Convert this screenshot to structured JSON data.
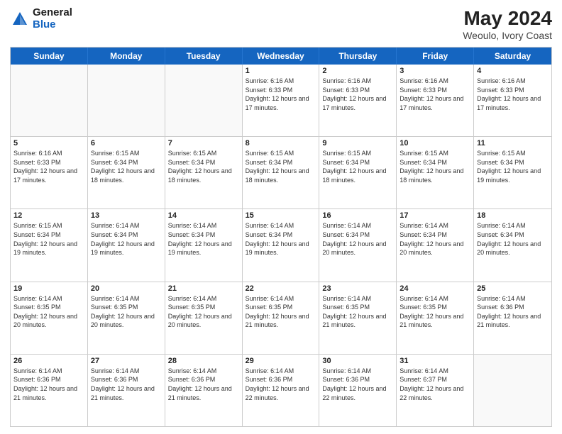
{
  "header": {
    "logo_general": "General",
    "logo_blue": "Blue",
    "month_title": "May 2024",
    "location": "Weoulo, Ivory Coast"
  },
  "days_of_week": [
    "Sunday",
    "Monday",
    "Tuesday",
    "Wednesday",
    "Thursday",
    "Friday",
    "Saturday"
  ],
  "weeks": [
    [
      {
        "day": "",
        "info": ""
      },
      {
        "day": "",
        "info": ""
      },
      {
        "day": "",
        "info": ""
      },
      {
        "day": "1",
        "info": "Sunrise: 6:16 AM\nSunset: 6:33 PM\nDaylight: 12 hours and 17 minutes."
      },
      {
        "day": "2",
        "info": "Sunrise: 6:16 AM\nSunset: 6:33 PM\nDaylight: 12 hours and 17 minutes."
      },
      {
        "day": "3",
        "info": "Sunrise: 6:16 AM\nSunset: 6:33 PM\nDaylight: 12 hours and 17 minutes."
      },
      {
        "day": "4",
        "info": "Sunrise: 6:16 AM\nSunset: 6:33 PM\nDaylight: 12 hours and 17 minutes."
      }
    ],
    [
      {
        "day": "5",
        "info": "Sunrise: 6:16 AM\nSunset: 6:33 PM\nDaylight: 12 hours and 17 minutes."
      },
      {
        "day": "6",
        "info": "Sunrise: 6:15 AM\nSunset: 6:34 PM\nDaylight: 12 hours and 18 minutes."
      },
      {
        "day": "7",
        "info": "Sunrise: 6:15 AM\nSunset: 6:34 PM\nDaylight: 12 hours and 18 minutes."
      },
      {
        "day": "8",
        "info": "Sunrise: 6:15 AM\nSunset: 6:34 PM\nDaylight: 12 hours and 18 minutes."
      },
      {
        "day": "9",
        "info": "Sunrise: 6:15 AM\nSunset: 6:34 PM\nDaylight: 12 hours and 18 minutes."
      },
      {
        "day": "10",
        "info": "Sunrise: 6:15 AM\nSunset: 6:34 PM\nDaylight: 12 hours and 18 minutes."
      },
      {
        "day": "11",
        "info": "Sunrise: 6:15 AM\nSunset: 6:34 PM\nDaylight: 12 hours and 19 minutes."
      }
    ],
    [
      {
        "day": "12",
        "info": "Sunrise: 6:15 AM\nSunset: 6:34 PM\nDaylight: 12 hours and 19 minutes."
      },
      {
        "day": "13",
        "info": "Sunrise: 6:14 AM\nSunset: 6:34 PM\nDaylight: 12 hours and 19 minutes."
      },
      {
        "day": "14",
        "info": "Sunrise: 6:14 AM\nSunset: 6:34 PM\nDaylight: 12 hours and 19 minutes."
      },
      {
        "day": "15",
        "info": "Sunrise: 6:14 AM\nSunset: 6:34 PM\nDaylight: 12 hours and 19 minutes."
      },
      {
        "day": "16",
        "info": "Sunrise: 6:14 AM\nSunset: 6:34 PM\nDaylight: 12 hours and 20 minutes."
      },
      {
        "day": "17",
        "info": "Sunrise: 6:14 AM\nSunset: 6:34 PM\nDaylight: 12 hours and 20 minutes."
      },
      {
        "day": "18",
        "info": "Sunrise: 6:14 AM\nSunset: 6:34 PM\nDaylight: 12 hours and 20 minutes."
      }
    ],
    [
      {
        "day": "19",
        "info": "Sunrise: 6:14 AM\nSunset: 6:35 PM\nDaylight: 12 hours and 20 minutes."
      },
      {
        "day": "20",
        "info": "Sunrise: 6:14 AM\nSunset: 6:35 PM\nDaylight: 12 hours and 20 minutes."
      },
      {
        "day": "21",
        "info": "Sunrise: 6:14 AM\nSunset: 6:35 PM\nDaylight: 12 hours and 20 minutes."
      },
      {
        "day": "22",
        "info": "Sunrise: 6:14 AM\nSunset: 6:35 PM\nDaylight: 12 hours and 21 minutes."
      },
      {
        "day": "23",
        "info": "Sunrise: 6:14 AM\nSunset: 6:35 PM\nDaylight: 12 hours and 21 minutes."
      },
      {
        "day": "24",
        "info": "Sunrise: 6:14 AM\nSunset: 6:35 PM\nDaylight: 12 hours and 21 minutes."
      },
      {
        "day": "25",
        "info": "Sunrise: 6:14 AM\nSunset: 6:36 PM\nDaylight: 12 hours and 21 minutes."
      }
    ],
    [
      {
        "day": "26",
        "info": "Sunrise: 6:14 AM\nSunset: 6:36 PM\nDaylight: 12 hours and 21 minutes."
      },
      {
        "day": "27",
        "info": "Sunrise: 6:14 AM\nSunset: 6:36 PM\nDaylight: 12 hours and 21 minutes."
      },
      {
        "day": "28",
        "info": "Sunrise: 6:14 AM\nSunset: 6:36 PM\nDaylight: 12 hours and 21 minutes."
      },
      {
        "day": "29",
        "info": "Sunrise: 6:14 AM\nSunset: 6:36 PM\nDaylight: 12 hours and 22 minutes."
      },
      {
        "day": "30",
        "info": "Sunrise: 6:14 AM\nSunset: 6:36 PM\nDaylight: 12 hours and 22 minutes."
      },
      {
        "day": "31",
        "info": "Sunrise: 6:14 AM\nSunset: 6:37 PM\nDaylight: 12 hours and 22 minutes."
      },
      {
        "day": "",
        "info": ""
      }
    ]
  ]
}
